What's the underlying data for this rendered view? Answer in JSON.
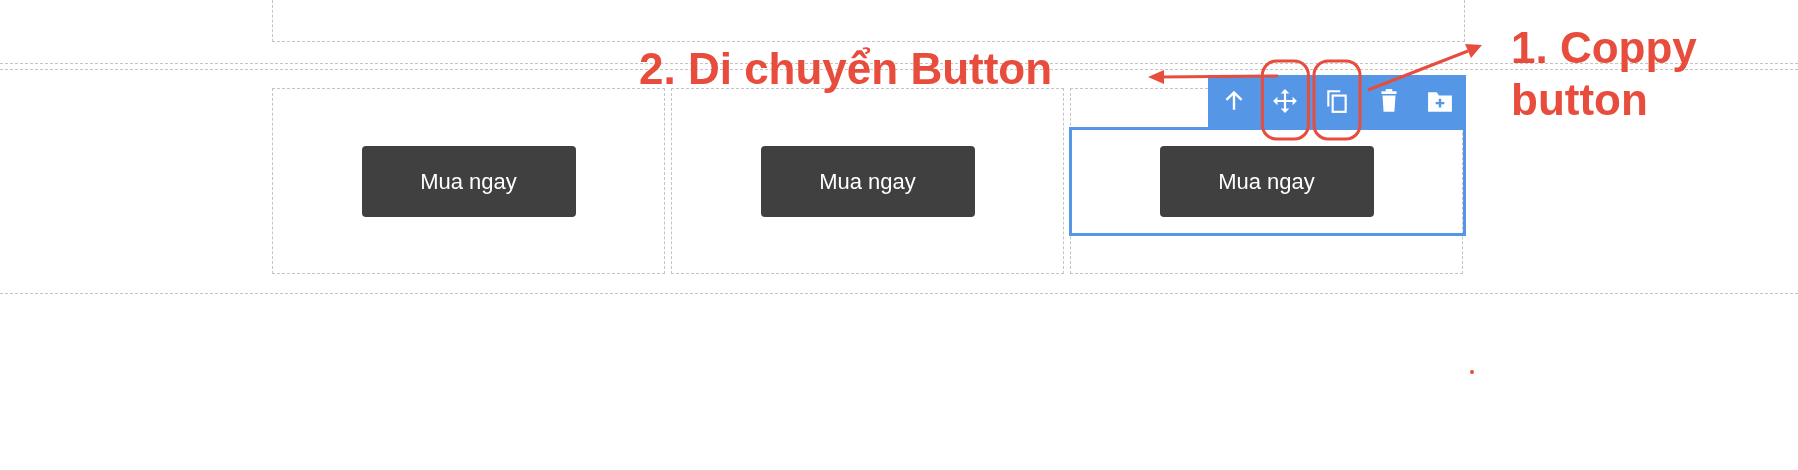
{
  "columns": [
    {
      "button": "Mua ngay",
      "selected": false
    },
    {
      "button": "Mua ngay",
      "selected": false
    },
    {
      "button": "Mua ngay",
      "selected": true
    }
  ],
  "toolbar": {
    "icons": [
      {
        "kind": "up",
        "highlighted": false
      },
      {
        "kind": "move",
        "highlighted": true
      },
      {
        "kind": "copy",
        "highlighted": true
      },
      {
        "kind": "delete",
        "highlighted": false
      },
      {
        "kind": "add-folder",
        "highlighted": false
      }
    ]
  },
  "annotations": [
    {
      "text": "2. Di chuyển Button"
    },
    {
      "text": "1. Coppy button"
    }
  ]
}
